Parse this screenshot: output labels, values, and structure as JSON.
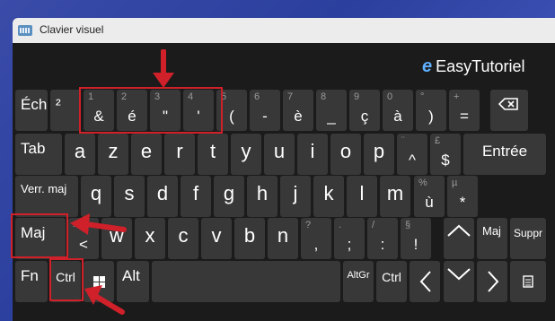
{
  "window": {
    "title": "Clavier visuel"
  },
  "brand": {
    "logo": "e",
    "name": "EasyTutoriel"
  },
  "row1": [
    {
      "name": "key-escape",
      "label": "Éch"
    },
    {
      "name": "key-superscript-2",
      "label": "²"
    },
    {
      "name": "key-1",
      "shift": "1",
      "main": "&"
    },
    {
      "name": "key-2",
      "shift": "2",
      "main": "é"
    },
    {
      "name": "key-3",
      "shift": "3",
      "main": "\""
    },
    {
      "name": "key-4",
      "shift": "4",
      "main": "'"
    },
    {
      "name": "key-5",
      "shift": "5",
      "main": "("
    },
    {
      "name": "key-6",
      "shift": "6",
      "main": "-"
    },
    {
      "name": "key-7",
      "shift": "7",
      "main": "è"
    },
    {
      "name": "key-8",
      "shift": "8",
      "main": "_"
    },
    {
      "name": "key-9",
      "shift": "9",
      "main": "ç"
    },
    {
      "name": "key-0",
      "shift": "0",
      "main": "à"
    },
    {
      "name": "key-degree",
      "shift": "°",
      "main": ")"
    },
    {
      "name": "key-plus",
      "shift": "+",
      "main": "="
    }
  ],
  "row2_letters": [
    "a",
    "z",
    "e",
    "r",
    "t",
    "y",
    "u",
    "i",
    "o",
    "p"
  ],
  "row2_extra": [
    {
      "name": "key-circumflex",
      "shift": "¨",
      "main": "^"
    },
    {
      "name": "key-dollar",
      "shift": "£",
      "main": "$"
    }
  ],
  "row3_letters": [
    "q",
    "s",
    "d",
    "f",
    "g",
    "h",
    "j",
    "k",
    "l",
    "m"
  ],
  "row3_extra": [
    {
      "name": "key-u-grave",
      "shift": "%",
      "main": "ù"
    },
    {
      "name": "key-asterisk",
      "shift": "µ",
      "main": "*"
    }
  ],
  "row4_letters": [
    "w",
    "x",
    "c",
    "v",
    "b",
    "n"
  ],
  "row4_extra": [
    {
      "name": "key-comma",
      "shift": "?",
      "main": ","
    },
    {
      "name": "key-semicolon",
      "shift": ".",
      "main": ";"
    },
    {
      "name": "key-colon",
      "shift": "/",
      "main": ":"
    },
    {
      "name": "key-exclamation",
      "shift": "§",
      "main": "!"
    }
  ],
  "labels": {
    "tab": "Tab",
    "enter": "Entrée",
    "caps": "Verr. maj",
    "shift": "Maj",
    "shift_right": "Maj",
    "lt_shift": ">",
    "lt_main": "<",
    "delete": "Suppr",
    "fn": "Fn",
    "ctrl": "Ctrl",
    "alt": "Alt",
    "altgr": "AltGr",
    "ctrl_right": "Ctrl"
  },
  "icons": {
    "backspace": "backspace-icon",
    "windows": "windows-icon",
    "menu": "context-menu-icon",
    "up": "arrow-up-icon",
    "down": "arrow-down-icon",
    "left": "arrow-left-icon",
    "right": "arrow-right-icon"
  },
  "colors": {
    "highlight": "#d0202a",
    "key": "#383838",
    "background": "#1b1b1b"
  }
}
